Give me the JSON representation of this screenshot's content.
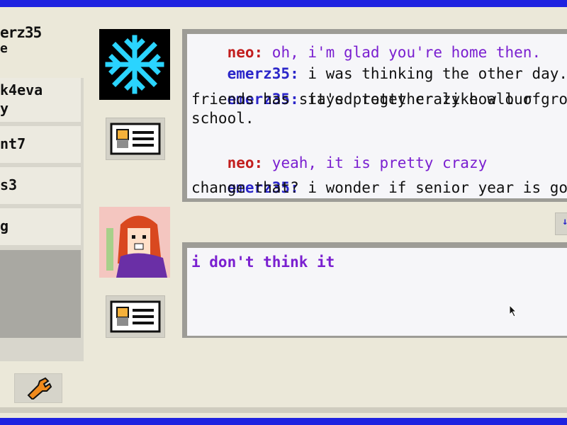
{
  "user": {
    "name": "erz35",
    "status": "e"
  },
  "buddies": [
    {
      "label": "k4eva\ny",
      "selected": false
    },
    {
      "label": "nt7",
      "selected": false
    },
    {
      "label": "s3",
      "selected": false
    },
    {
      "label": "g",
      "selected": false
    },
    {
      "label": "",
      "selected": true
    }
  ],
  "chat": {
    "messages": [
      {
        "sender": "neo:",
        "text": " oh, i'm glad you're home then.",
        "kind": "neo"
      },
      {
        "sender": "emerz35:",
        "text": " i was thinking the other day.",
        "kind": "emerz"
      },
      {
        "sender": "emerz35:",
        "text": " it's pretty crazy how our gro",
        "cont": "friends has stayed together like all of\nschool.",
        "kind": "emerz"
      },
      {
        "sender": "neo:",
        "text": " yeah, it is pretty crazy",
        "kind": "neo"
      },
      {
        "sender": "emerz35:",
        "text": " i wonder if senior year is goin",
        "cont": "change that?",
        "kind": "emerz"
      }
    ]
  },
  "compose": {
    "value": "i don't think it"
  },
  "icons": {
    "friend_avatar": "snowflake-icon",
    "profile": "id-card-icon",
    "settings": "wrench-icon",
    "scroll": "arrow-icon"
  },
  "colors": {
    "border_blue": "#1e22e0",
    "emerz_name": "#2b26c9",
    "neo_name": "#c21e1e",
    "neo_text": "#7a1fd0"
  }
}
